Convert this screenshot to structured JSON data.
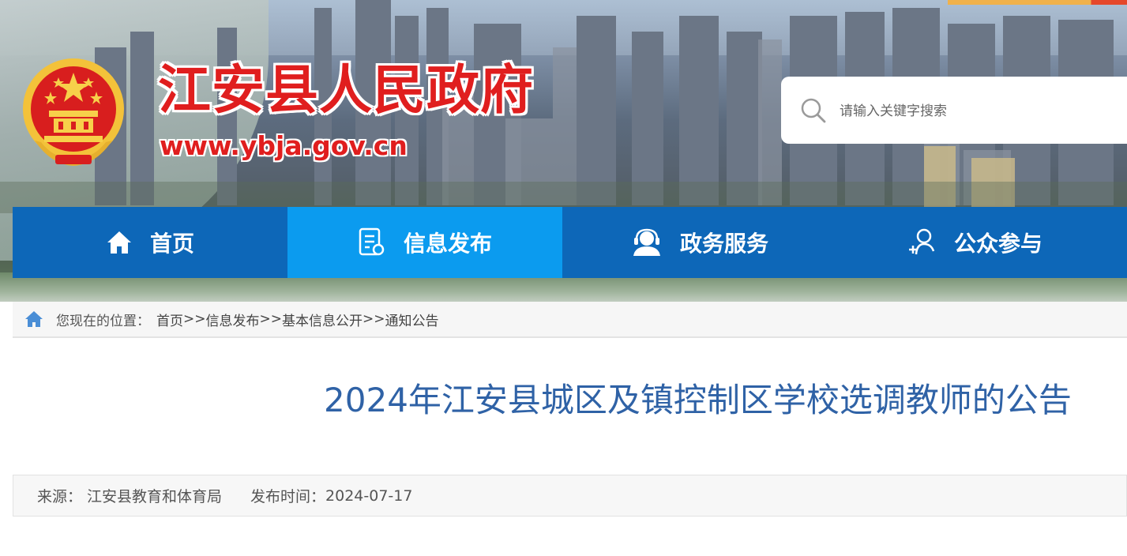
{
  "site": {
    "title": "江安县人民政府",
    "url": "www.ybja.gov.cn"
  },
  "search": {
    "placeholder": "请输入关键字搜索"
  },
  "nav": {
    "items": [
      {
        "label": "首页",
        "icon": "home-icon"
      },
      {
        "label": "信息发布",
        "icon": "document-icon",
        "active": true
      },
      {
        "label": "政务服务",
        "icon": "service-agent-icon"
      },
      {
        "label": "公众参与",
        "icon": "add-user-icon"
      }
    ]
  },
  "breadcrumb": {
    "prefix": "您现在的位置：",
    "items": [
      "首页",
      "信息发布",
      "基本信息公开",
      "通知公告"
    ],
    "separator": ">>"
  },
  "article": {
    "title": "2024年江安县城区及镇控制区学校选调教师的公告",
    "source_label": "来源：",
    "source": "江安县教育和体育局",
    "date_label": "发布时间：",
    "date": "2024-07-17"
  },
  "colors": {
    "nav": "#0d67b8",
    "nav_active": "#0b9bef",
    "title": "#2f62a6",
    "site_title": "#e01e1e"
  }
}
